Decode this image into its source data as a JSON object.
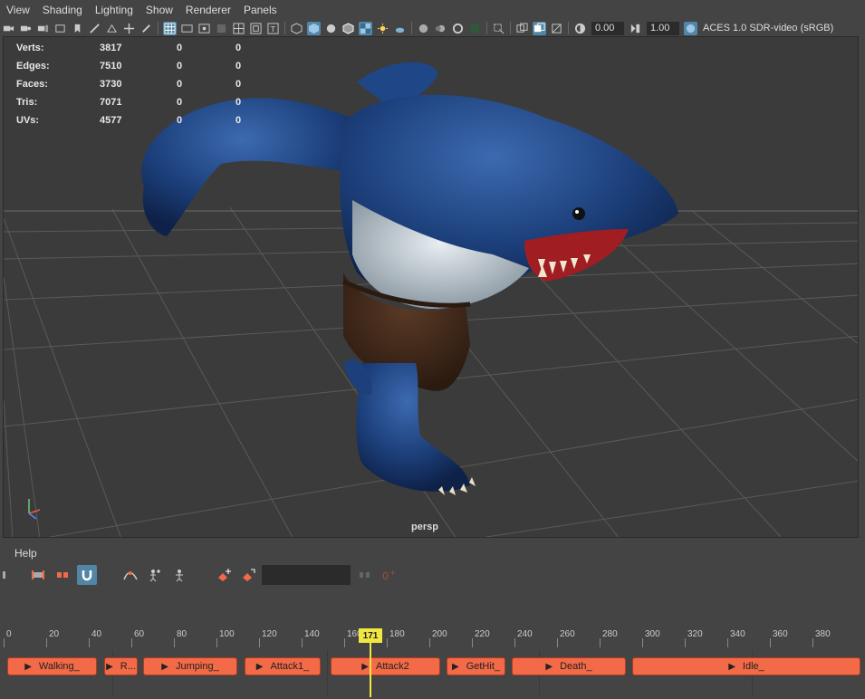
{
  "menu": [
    "View",
    "Shading",
    "Lighting",
    "Show",
    "Renderer",
    "Panels"
  ],
  "toolbar": {
    "exposure": "0.00",
    "gamma": "1.00",
    "color_space": "ACES 1.0 SDR-video (sRGB)"
  },
  "hud": {
    "rows": [
      {
        "label": "Verts:",
        "v1": "3817",
        "v2": "0",
        "v3": "0"
      },
      {
        "label": "Edges:",
        "v1": "7510",
        "v2": "0",
        "v3": "0"
      },
      {
        "label": "Faces:",
        "v1": "3730",
        "v2": "0",
        "v3": "0"
      },
      {
        "label": "Tris:",
        "v1": "7071",
        "v2": "0",
        "v3": "0"
      },
      {
        "label": "UVs:",
        "v1": "4577",
        "v2": "0",
        "v3": "0"
      }
    ]
  },
  "camera_label": "persp",
  "lower_menu": {
    "help": "Help"
  },
  "timeline": {
    "labels": [
      "0",
      "20",
      "40",
      "60",
      "80",
      "100",
      "120",
      "140",
      "160",
      "180",
      "200",
      "220",
      "240",
      "260",
      "280",
      "300",
      "320",
      "340",
      "360",
      "380"
    ],
    "current_frame": "171"
  },
  "clips": [
    "Walking_",
    "R...",
    "Jumping_",
    "Attack1_",
    "Attack2",
    "GetHit_",
    "Death_",
    "Idle_"
  ],
  "colors": {
    "accent": "#5285a6",
    "clip": "#f26a47",
    "playhead": "#f2e640"
  }
}
